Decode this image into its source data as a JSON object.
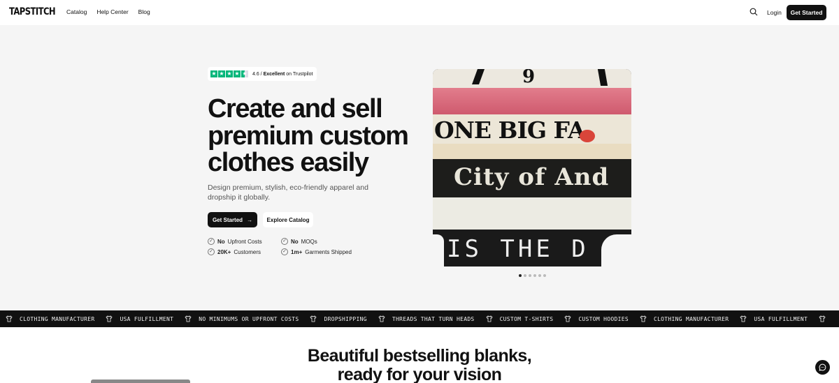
{
  "brand": {
    "logo_text": "TAPSTITCH"
  },
  "nav": {
    "links": [
      "Catalog",
      "Help Center",
      "Blog"
    ],
    "login_label": "Login",
    "cta_label": "Get Started"
  },
  "hero": {
    "trustpilot": {
      "rating": "4.6",
      "rating_word": "Excellent",
      "suffix": "on Trustpilot",
      "stars_filled": 4.5
    },
    "headline": "Create and sell premium custom clothes easily",
    "subheadline": "Design premium, stylish, eco-friendly apparel and dropship it globally.",
    "primary_cta": "Get Started",
    "secondary_cta": "Explore Catalog",
    "features": [
      {
        "bold": "No",
        "text": "Upfront Costs"
      },
      {
        "bold": "No",
        "text": "MOQs"
      },
      {
        "bold": "20K+",
        "text": "Customers"
      },
      {
        "bold": "1m+",
        "text": "Garments Shipped"
      }
    ],
    "image_texts": [
      "9",
      "ONE BIG FA",
      "City of And",
      "IS THE D"
    ],
    "carousel": {
      "count": 6,
      "active_index": 0
    }
  },
  "ticker": {
    "items": [
      "CLOTHING MANUFACTURER",
      "USA FULFILLMENT",
      "NO MINIMUMS OR UPFRONT COSTS",
      "DROPSHIPPING",
      "THREADS THAT TURN HEADS",
      "CUSTOM T-SHIRTS",
      "CUSTOM HOODIES",
      "CLOTHING MANUFACTURER",
      "USA FULFILLMENT"
    ]
  },
  "section": {
    "title_line1": "Beautiful bestselling blanks,",
    "title_line2": "ready for your vision"
  },
  "colors": {
    "accent": "#111111",
    "trustpilot_green": "#00b67a",
    "background": "#f5f5f5"
  }
}
